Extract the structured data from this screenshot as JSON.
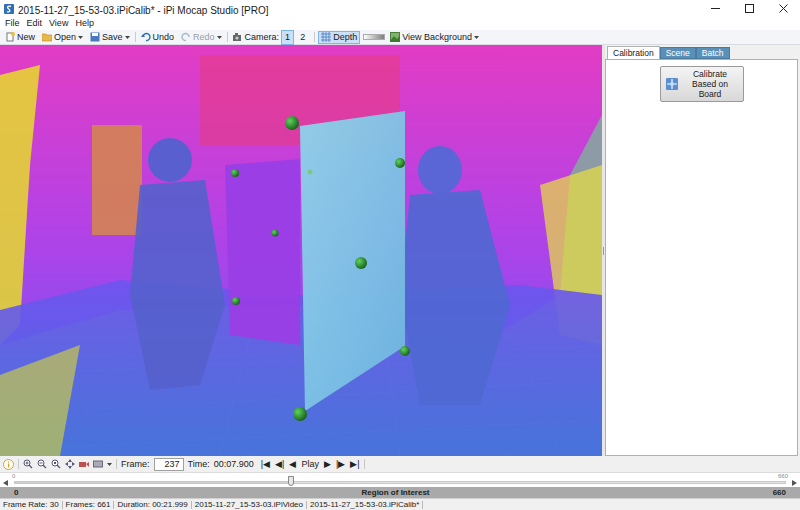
{
  "window": {
    "title": "2015-11-27_15-53-03.iPiCalib* - iPi Mocap Studio [PRO]"
  },
  "menu": [
    "File",
    "Edit",
    "View",
    "Help"
  ],
  "toolbar": {
    "new": "New",
    "open": "Open",
    "save": "Save",
    "undo": {
      "label": "Undo",
      "disabled": false
    },
    "redo": {
      "label": "Redo",
      "disabled": true
    },
    "camera_label": "Camera:",
    "cameras": [
      {
        "label": "1",
        "selected": true
      },
      {
        "label": "2",
        "selected": false
      }
    ],
    "depth": {
      "label": "Depth",
      "selected": true
    },
    "view_background": "View Background"
  },
  "panel": {
    "tabs": [
      {
        "label": "Calibration",
        "selected": true
      },
      {
        "label": "Scene",
        "selected": false
      },
      {
        "label": "Batch",
        "selected": false
      }
    ],
    "calibrate_button": "Calibrate Based on Board"
  },
  "playback": {
    "frame_label": "Frame:",
    "frame": "237",
    "time_label": "Time:",
    "time": "00:07.900",
    "controls": [
      "|◀",
      "◀|",
      "◀",
      "Play",
      "▶",
      "|▶",
      "▶|"
    ]
  },
  "timeline": {
    "start": "0",
    "end": "660",
    "level": 0.359
  },
  "roi": {
    "start": "0",
    "label": "Region of Interest",
    "end": "660"
  },
  "status_bar": [
    "Frame Rate: 30",
    "Frames: 661",
    "Duration: 00:21.999",
    "2015-11-27_15-53-03.iPiVideo",
    "2015-11-27_15-53-03.iPiCalib*"
  ]
}
